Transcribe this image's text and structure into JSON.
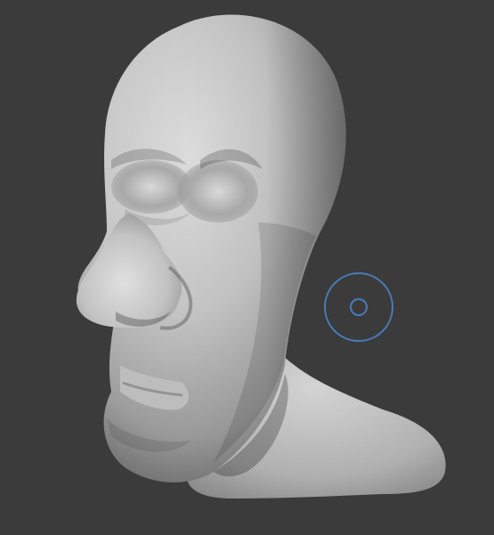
{
  "viewport": {
    "background": "#3b3b3b",
    "mode": "sculpt"
  },
  "model": {
    "name": "sculpted-head",
    "surface_color": "#c4c4c4",
    "shadow_color": "#5a5a5a"
  },
  "brush": {
    "icon": "brush-cursor-icon",
    "ring_color": "#4a7ab7"
  }
}
